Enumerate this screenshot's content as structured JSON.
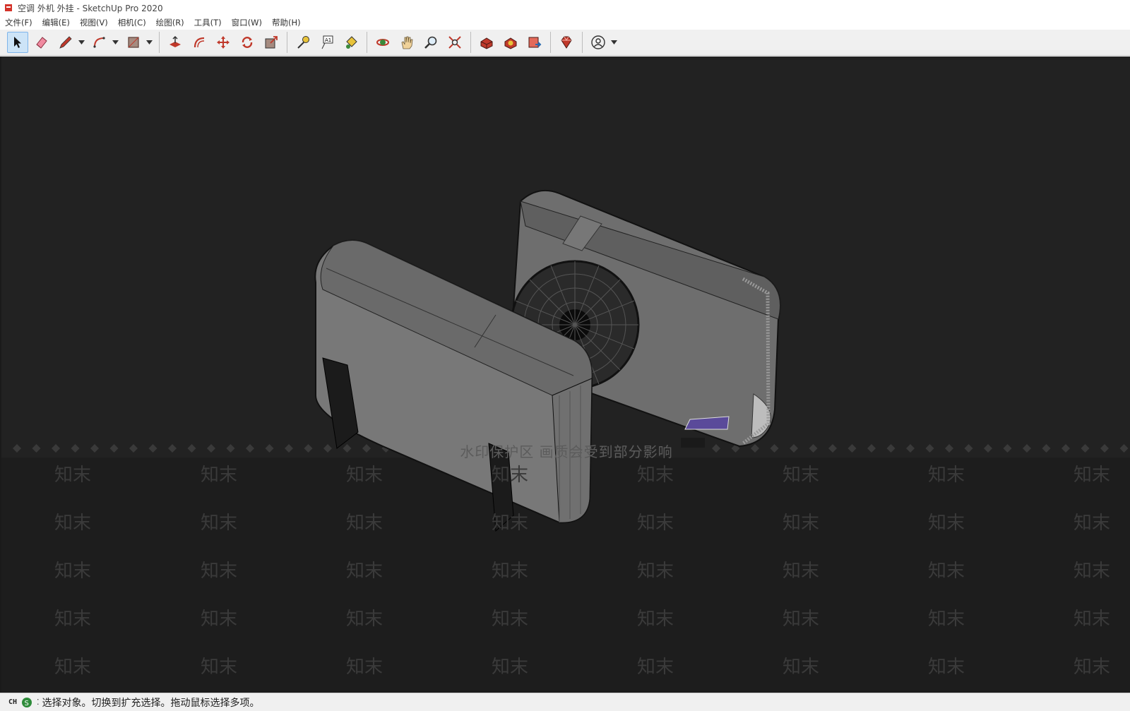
{
  "window": {
    "title": "空调 外机 外挂 - SketchUp Pro 2020"
  },
  "menu": [
    "文件(F)",
    "编辑(E)",
    "视图(V)",
    "相机(C)",
    "绘图(R)",
    "工具(T)",
    "窗口(W)",
    "帮助(H)"
  ],
  "toolbar": {
    "tools": [
      {
        "icon": "select-arrow-icon",
        "active": true
      },
      {
        "icon": "eraser-icon"
      },
      {
        "icon": "pencil-line-icon",
        "dropdown": true
      },
      {
        "icon": "arc-icon",
        "dropdown": true
      },
      {
        "icon": "rectangle-icon",
        "dropdown": true
      },
      {
        "icon": "push-pull-icon"
      },
      {
        "icon": "offset-icon"
      },
      {
        "icon": "move-icon"
      },
      {
        "icon": "rotate-icon"
      },
      {
        "icon": "scale-icon"
      },
      {
        "icon": "tape-measure-icon"
      },
      {
        "icon": "text-tool-icon"
      },
      {
        "icon": "paint-bucket-icon"
      },
      {
        "icon": "orbit-icon"
      },
      {
        "icon": "pan-hand-icon"
      },
      {
        "icon": "zoom-icon"
      },
      {
        "icon": "zoom-extents-icon"
      },
      {
        "icon": "warehouse-icon"
      },
      {
        "icon": "extension-warehouse-icon"
      },
      {
        "icon": "layout-send-icon"
      },
      {
        "icon": "extension-manager-ruby-icon"
      },
      {
        "icon": "account-user-icon",
        "dropdown": true
      }
    ]
  },
  "viewport": {
    "background": "#222222",
    "watermark_notice": "水印保护区   画质会受到部分影响",
    "watermark_word": "知末"
  },
  "status": {
    "input_method": "CH",
    "message": "选择对象。切换到扩充选择。拖动鼠标选择多项。"
  }
}
